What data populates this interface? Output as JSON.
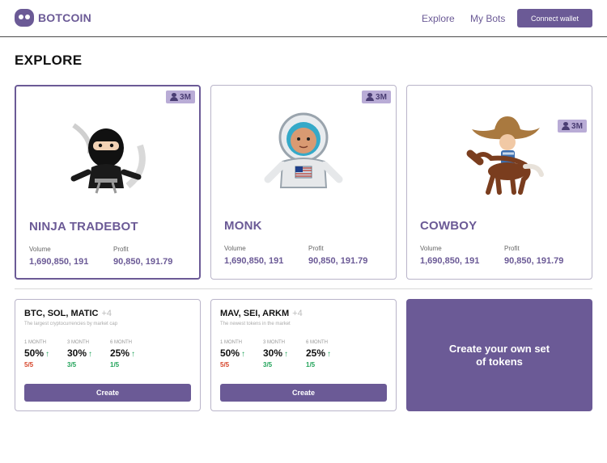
{
  "header": {
    "brand": "BOTCOIN",
    "nav": [
      "Explore",
      "My Bots"
    ],
    "connect_label": "Connect wallet"
  },
  "page": {
    "title": "EXPLORE"
  },
  "bots": [
    {
      "name": "NINJA TRADEBOT",
      "users": "3M",
      "volume_label": "Volume",
      "volume": "1,690,850, 191",
      "profit_label": "Profit",
      "profit": "90,850, 191.79",
      "avatar_icon": "ninja-icon"
    },
    {
      "name": "MONK",
      "users": "3M",
      "volume_label": "Volume",
      "volume": "1,690,850, 191",
      "profit_label": "Profit",
      "profit": "90,850, 191.79",
      "avatar_icon": "astronaut-icon"
    },
    {
      "name": "COWBOY",
      "users": "3M",
      "volume_label": "Volume",
      "volume": "1,690,850, 191",
      "profit_label": "Profit",
      "profit": "90,850, 191.79",
      "avatar_icon": "cowboy-icon"
    }
  ],
  "token_sets": [
    {
      "title": "BTC, SOL, MATIC",
      "more": "+4",
      "description": "The largest cryptocurrencies by market cap",
      "periods": [
        {
          "label": "1 MONTH",
          "value": "50%",
          "score": "5/5",
          "score_color": "#d6452a"
        },
        {
          "label": "3 MONTH",
          "value": "30%",
          "score": "3/5",
          "score_color": "#22a35a"
        },
        {
          "label": "6 MONTH",
          "value": "25%",
          "score": "1/5",
          "score_color": "#22a35a"
        }
      ],
      "button_label": "Create"
    },
    {
      "title": "MAV, SEI, ARKM",
      "more": "+4",
      "description": "The newest tokens in the market",
      "periods": [
        {
          "label": "1 MONTH",
          "value": "50%",
          "score": "5/5",
          "score_color": "#d6452a"
        },
        {
          "label": "3 MONTH",
          "value": "30%",
          "score": "3/5",
          "score_color": "#22a35a"
        },
        {
          "label": "6 MONTH",
          "value": "25%",
          "score": "1/5",
          "score_color": "#22a35a"
        }
      ],
      "button_label": "Create"
    }
  ],
  "create_own_label": "Create your own set of tokens",
  "colors": {
    "accent": "#6b5a96",
    "badge": "#b9acd6",
    "positive": "#22a35a",
    "negative": "#d6452a"
  }
}
